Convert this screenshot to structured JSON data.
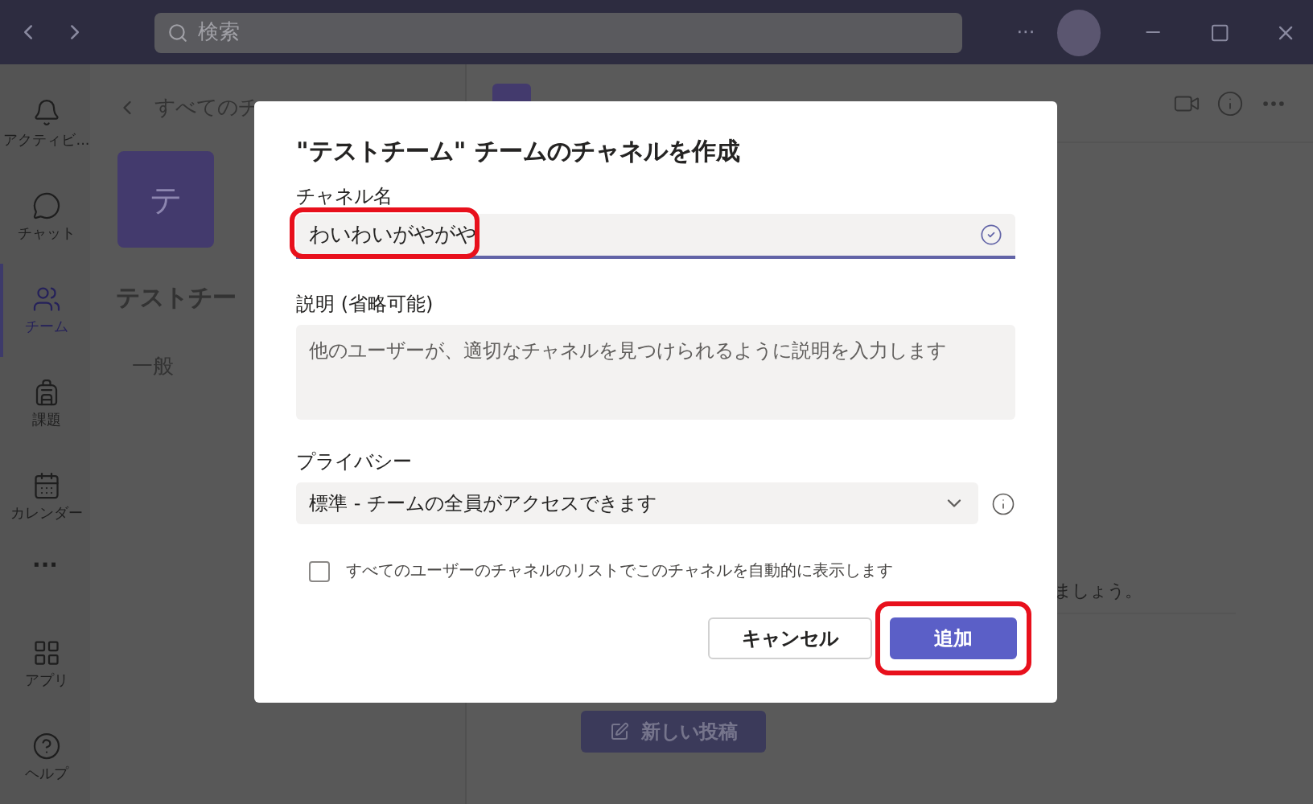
{
  "title_bar": {
    "search": {
      "placeholder": "検索"
    },
    "more": "···"
  },
  "rail": {
    "items": [
      {
        "label": "アクティビ...",
        "selected": false
      },
      {
        "label": "チャット",
        "selected": false
      },
      {
        "label": "チーム",
        "selected": true
      },
      {
        "label": "課題",
        "selected": false
      },
      {
        "label": "カレンダー",
        "selected": false
      }
    ],
    "more": "···",
    "bottom_items": [
      {
        "label": "アプリ",
        "selected": false
      },
      {
        "label": "ヘルプ",
        "selected": false
      }
    ]
  },
  "team_panel": {
    "back": "すべてのチ",
    "avatar": "テ",
    "team_name": "テストチー",
    "channels": [
      {
        "name": "一般",
        "selected": false
      }
    ]
  },
  "main": {
    "hint": "ましょう。",
    "new_post": "新しい投稿"
  },
  "dialog": {
    "title": "\"テストチーム\" チームのチャネルを作成",
    "name_field": {
      "label": "チャネル名",
      "value": "わいわいがやがや",
      "valid": true,
      "highlighted": true
    },
    "description": {
      "label": "説明 (省略可能)",
      "placeholder": "他のユーザーが、適切なチャネルを見つけられるように説明を入力します"
    },
    "privacy": {
      "label": "プライバシー",
      "value": "標準 - チームの全員がアクセスできます"
    },
    "show_checkbox": {
      "label": "すべてのユーザーのチャネルのリストでこのチャネルを自動的に表示します",
      "checked": false
    },
    "buttons": [
      {
        "label": "キャンセル",
        "kind": "secondary",
        "highlighted": false
      },
      {
        "label": "追加",
        "kind": "primary",
        "highlighted": true
      }
    ]
  }
}
